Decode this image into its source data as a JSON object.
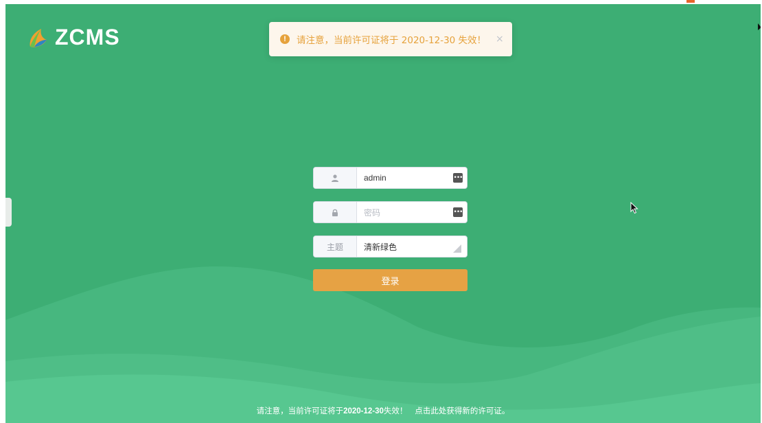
{
  "app": {
    "logo_text": "ZCMS",
    "logo_icon": "leaf-flame-logo-icon"
  },
  "toast": {
    "icon": "warning-circle-icon",
    "icon_glyph": "!",
    "message": "请注意，当前许可证将于 2020-12-30 失效！",
    "close_glyph": "×"
  },
  "login_form": {
    "username": {
      "icon": "user-icon",
      "value": "admin",
      "trailing_icon": "password-manager-icon"
    },
    "password": {
      "icon": "lock-icon",
      "placeholder": "密码",
      "trailing_icon": "password-manager-icon"
    },
    "theme": {
      "label": "主题",
      "selected": "清新绿色"
    },
    "submit_label": "登录"
  },
  "footer": {
    "prefix": "请注意，当前许可证将于",
    "date": "2020-12-30",
    "suffix": "失效！",
    "link_text": "点击此处获得新的许可证。"
  },
  "colors": {
    "background": "#3dae74",
    "hill_light": "#55c58f",
    "toast_bg": "#fdf6ec",
    "warning": "#e6a23c",
    "button": "#e6a244"
  }
}
